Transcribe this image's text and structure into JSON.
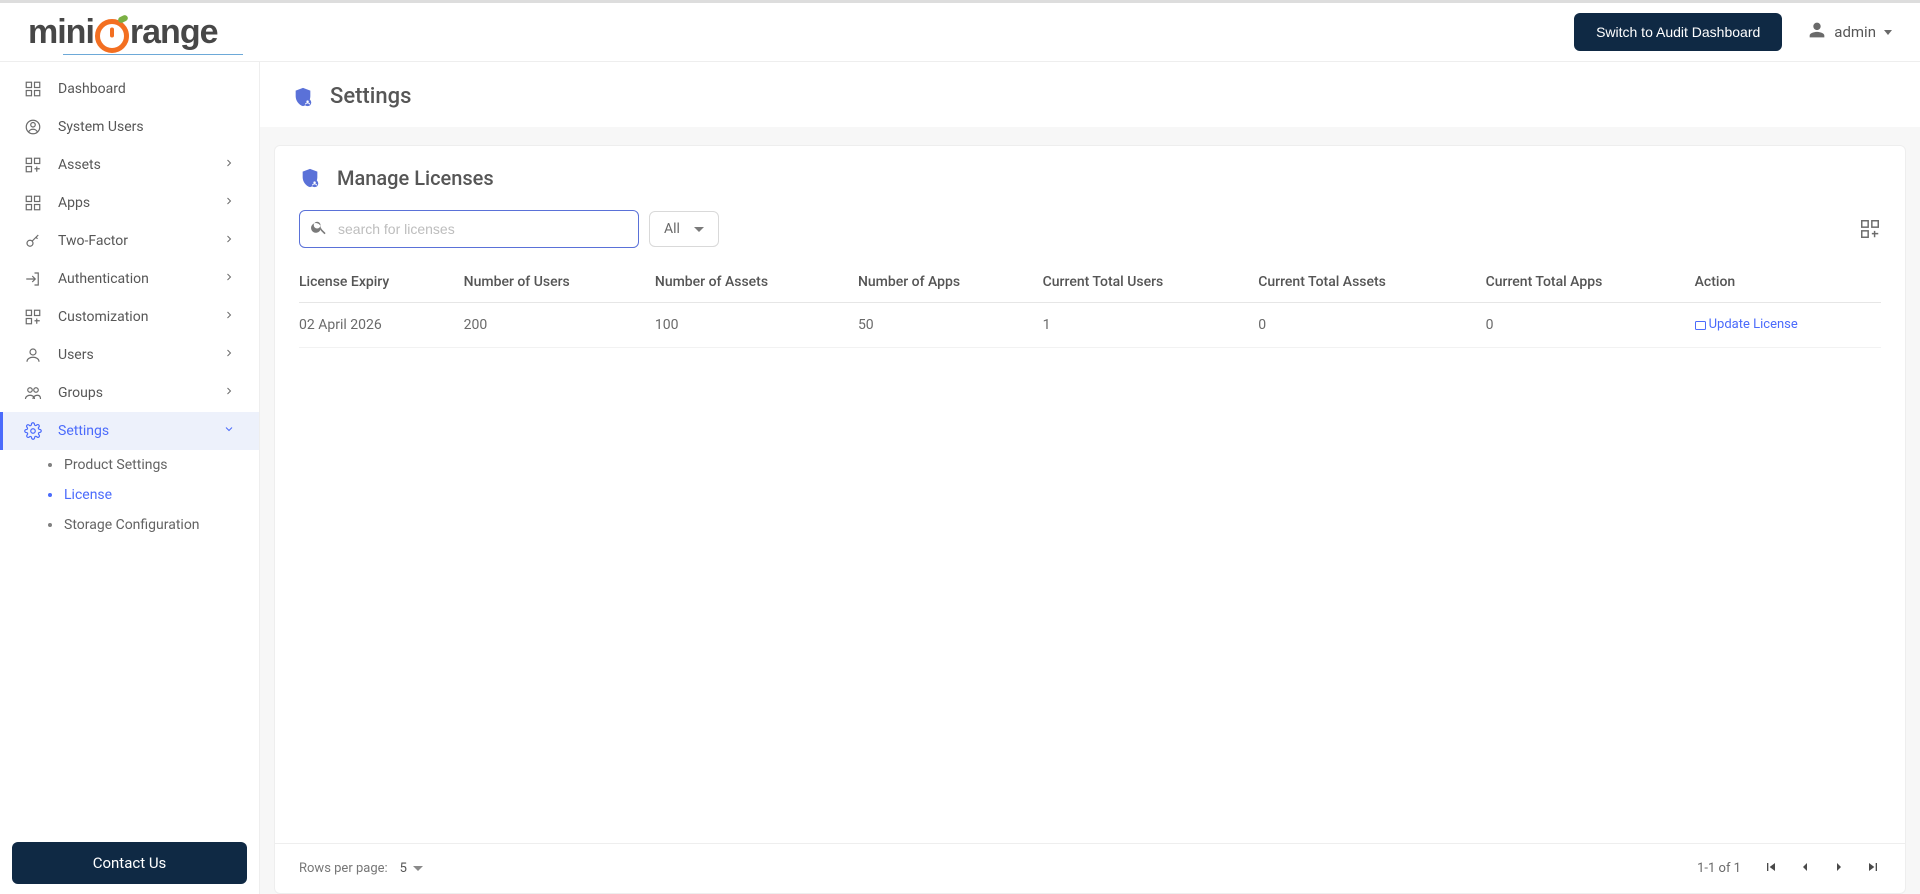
{
  "header": {
    "switch_button": "Switch to Audit Dashboard",
    "user_name": "admin"
  },
  "sidebar": {
    "items": [
      {
        "label": "Dashboard",
        "expandable": false
      },
      {
        "label": "System Users",
        "expandable": false
      },
      {
        "label": "Assets",
        "expandable": true
      },
      {
        "label": "Apps",
        "expandable": true
      },
      {
        "label": "Two-Factor",
        "expandable": true
      },
      {
        "label": "Authentication",
        "expandable": true
      },
      {
        "label": "Customization",
        "expandable": true
      },
      {
        "label": "Users",
        "expandable": true
      },
      {
        "label": "Groups",
        "expandable": true
      },
      {
        "label": "Settings",
        "expandable": true
      }
    ],
    "settings_sub": [
      {
        "label": "Product Settings"
      },
      {
        "label": "License"
      },
      {
        "label": "Storage Configuration"
      }
    ],
    "contact_button": "Contact Us"
  },
  "page": {
    "title": "Settings",
    "card_title": "Manage Licenses",
    "search_placeholder": "search for licenses",
    "filter_value": "All",
    "table": {
      "columns": [
        "License Expiry",
        "Number of Users",
        "Number of Assets",
        "Number of Apps",
        "Current Total Users",
        "Current Total Assets",
        "Current Total Apps",
        "Action"
      ],
      "rows": [
        {
          "expiry": "02 April 2026",
          "num_users": "200",
          "num_assets": "100",
          "num_apps": "50",
          "cur_users": "1",
          "cur_assets": "0",
          "cur_apps": "0",
          "action_label": "Update License"
        }
      ]
    },
    "pagination": {
      "rows_per_page_label": "Rows per page:",
      "rows_per_page_value": "5",
      "range_text": "1-1 of 1"
    }
  }
}
